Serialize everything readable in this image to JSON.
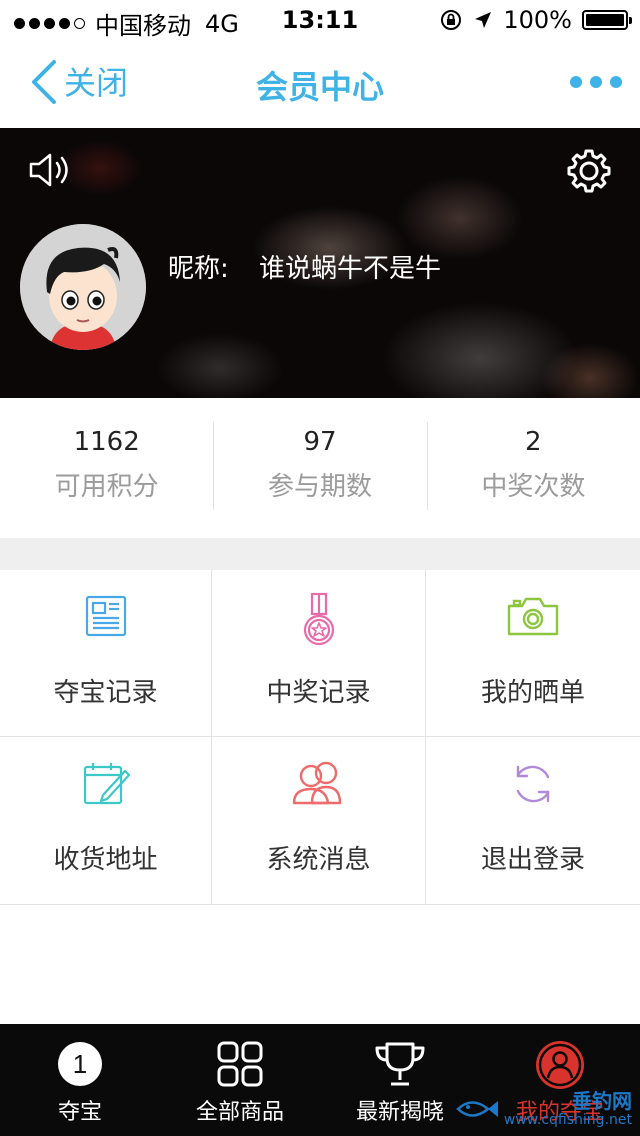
{
  "status_bar": {
    "carrier": "中国移动",
    "network": "4G",
    "time": "13:11",
    "battery": "100%"
  },
  "nav": {
    "back_label": "关闭",
    "title": "会员中心"
  },
  "profile": {
    "nickname_label": "昵称:",
    "nickname": "谁说蜗牛不是牛"
  },
  "stats": [
    {
      "value": "1162",
      "label": "可用积分"
    },
    {
      "value": "97",
      "label": "参与期数"
    },
    {
      "value": "2",
      "label": "中奖次数"
    }
  ],
  "menu": [
    {
      "label": "夺宝记录",
      "icon": "document-icon",
      "color": "#4aa8e8"
    },
    {
      "label": "中奖记录",
      "icon": "medal-icon",
      "color": "#e86aa8"
    },
    {
      "label": "我的晒单",
      "icon": "camera-icon",
      "color": "#8cc63f"
    },
    {
      "label": "收货地址",
      "icon": "calendar-pencil-icon",
      "color": "#3cc8c8"
    },
    {
      "label": "系统消息",
      "icon": "users-icon",
      "color": "#ee6b6b"
    },
    {
      "label": "退出登录",
      "icon": "refresh-icon",
      "color": "#b08ad8"
    }
  ],
  "tabs": [
    {
      "label": "夺宝",
      "icon": "number-one-icon",
      "badge": "1"
    },
    {
      "label": "全部商品",
      "icon": "grid-icon"
    },
    {
      "label": "最新揭晓",
      "icon": "trophy-icon"
    },
    {
      "label": "我的夺宝",
      "icon": "user-icon",
      "active": true
    }
  ],
  "watermark": {
    "title": "垂钓网",
    "url": "www.cqfishing.net"
  },
  "colors": {
    "accent": "#3fb2e6",
    "tab_active": "#d8332c"
  }
}
